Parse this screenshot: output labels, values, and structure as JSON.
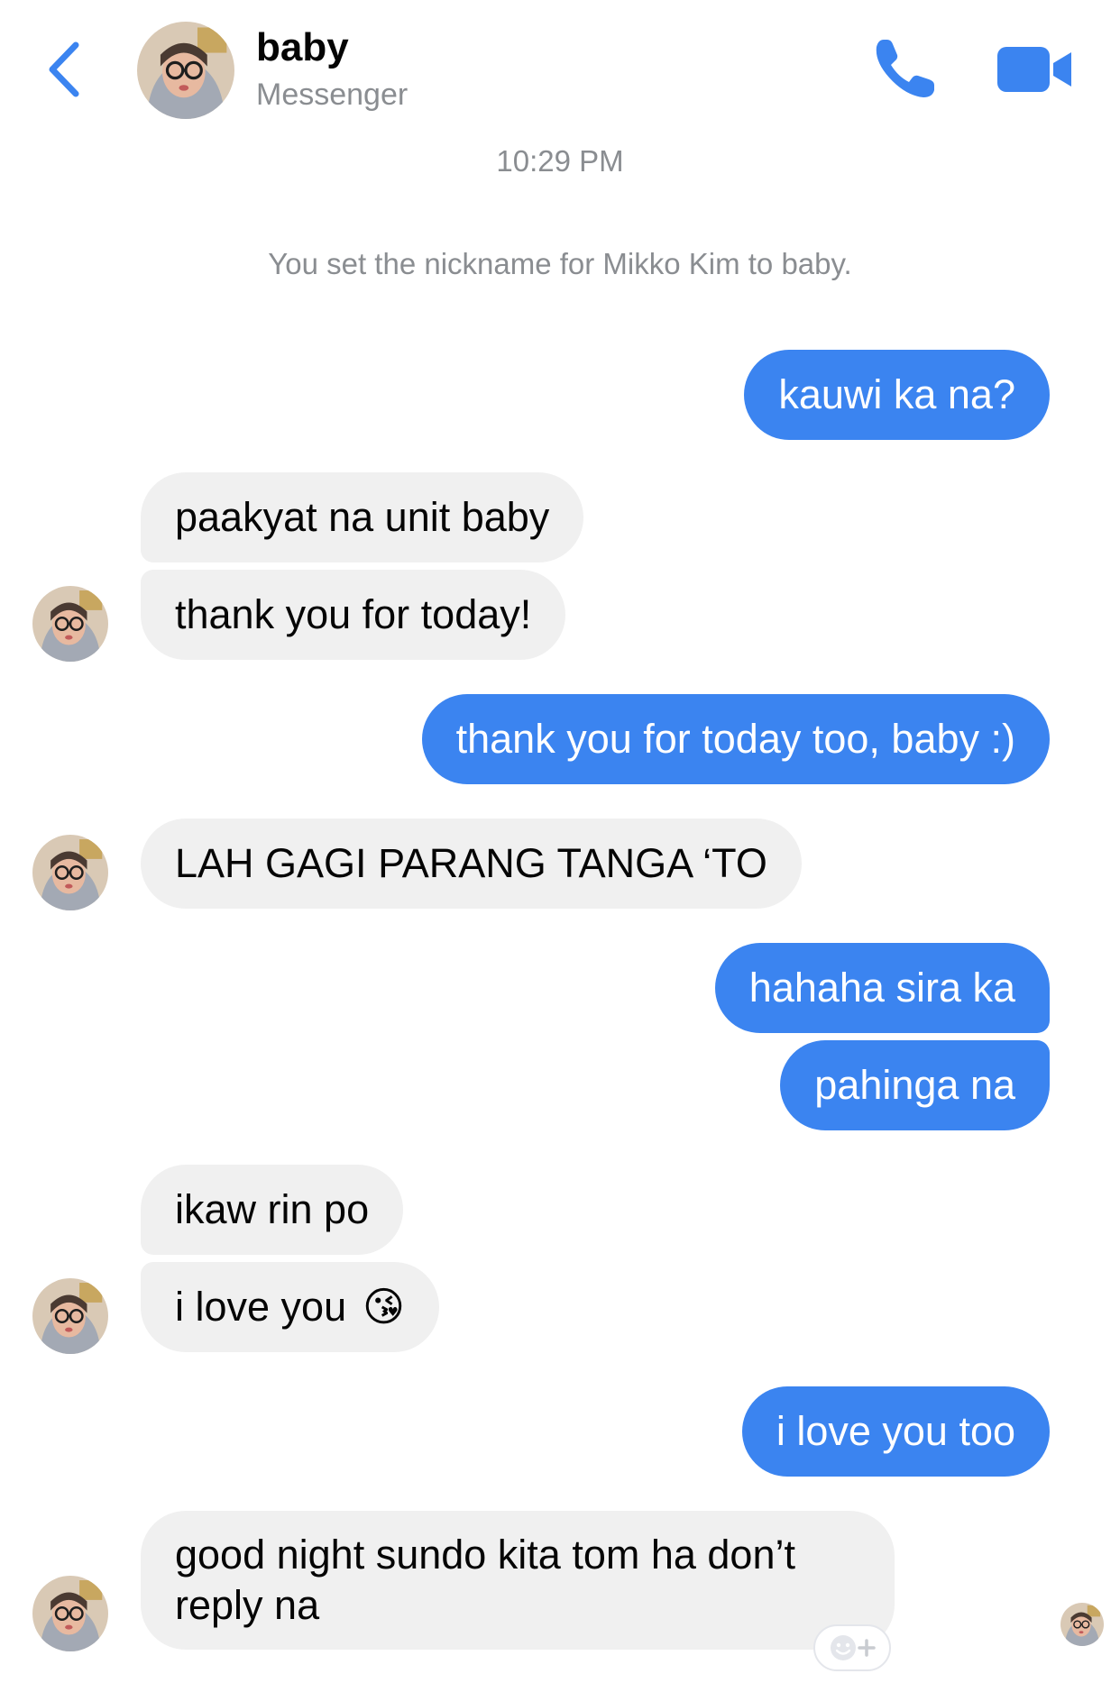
{
  "header": {
    "contact_name": "baby",
    "app_name": "Messenger"
  },
  "thread": {
    "timestamp": "10:29 PM",
    "system_message": "You set the nickname for Mikko Kim to baby."
  },
  "messages": [
    {
      "from": "me",
      "text": "kauwi ka na?"
    },
    {
      "from": "them",
      "text": "paakyat na unit baby"
    },
    {
      "from": "them",
      "text": "thank you for today!"
    },
    {
      "from": "me",
      "text": "thank you for today too, baby :)"
    },
    {
      "from": "them",
      "text": "LAH GAGI PARANG TANGA ‘TO"
    },
    {
      "from": "me",
      "text": "hahaha sira ka"
    },
    {
      "from": "me",
      "text": "pahinga na"
    },
    {
      "from": "them",
      "text": "ikaw rin po"
    },
    {
      "from": "them",
      "text": "i love you",
      "emoji": "😘"
    },
    {
      "from": "me",
      "text": "i love you too"
    },
    {
      "from": "them",
      "text": "good night sundo kita tom ha don’t reply na"
    }
  ],
  "icons": {
    "back": "chevron-left-icon",
    "call": "phone-icon",
    "video": "video-camera-icon",
    "react": "add-reaction-icon"
  },
  "colors": {
    "accent": "#3b84f0",
    "incoming_bubble": "#f0f0f0",
    "secondary_text": "#8a8d91"
  }
}
